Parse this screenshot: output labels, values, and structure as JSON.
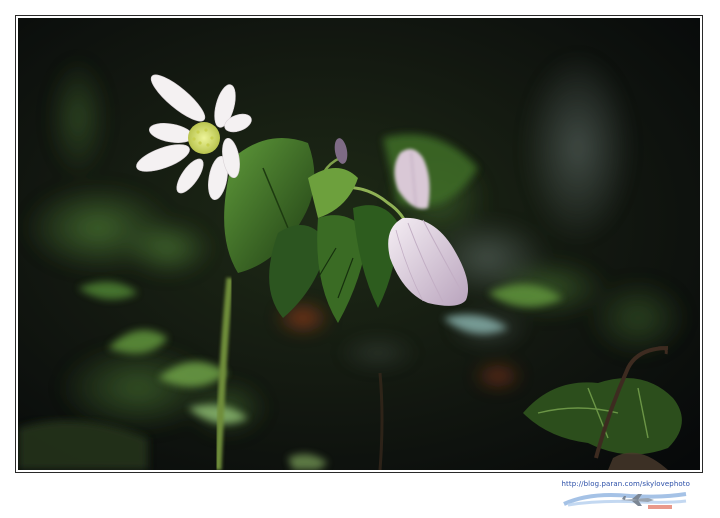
{
  "photo": {
    "subject": "white-flower",
    "colors": {
      "background": "#0e110c",
      "foliage": "#2f5a1f",
      "petal": "#f4f1f2",
      "bud": "#d9c8d6",
      "center": "#d7e36a",
      "accent": "#c9461f"
    }
  },
  "watermark": {
    "url": "http://blog.paran.com/skylovephoto",
    "logo_icon": "airplane-icon"
  }
}
